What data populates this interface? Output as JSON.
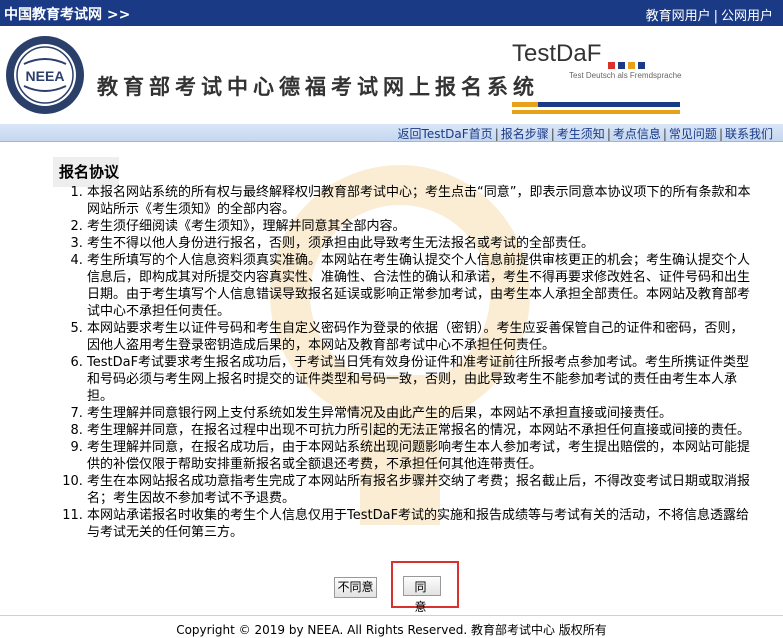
{
  "topbar": {
    "site": "中国教育考试网 >>",
    "user_link": "教育网用户",
    "separator": "|",
    "public_link": "公网用户"
  },
  "header": {
    "logo_text": "NEEA",
    "title": "教育部考试中心德福考试网上报名系统",
    "brand": "TestDaF",
    "brand_sub": "Test Deutsch als Fremdsprache"
  },
  "nav": {
    "items": [
      "返回TestDaF首页",
      "报名步骤",
      "考生须知",
      "考点信息",
      "常见问题",
      "联系我们"
    ]
  },
  "agreement": {
    "heading": "报名协议",
    "items": [
      "本报名网站系统的所有权与最终解释权归教育部考试中心；考生点击“同意”，即表示同意本协议项下的所有条款和本网站所示《考生须知》的全部内容。",
      "考生须仔细阅读《考生须知》，理解并同意其全部内容。",
      "考生不得以他人身份进行报名，否则，须承担由此导致考生无法报名或考试的全部责任。",
      "考生所填写的个人信息资料须真实准确。本网站在考生确认提交个人信息前提供审核更正的机会；考生确认提交个人信息后，即构成其对所提交内容真实性、准确性、合法性的确认和承诺，考生不得再要求修改姓名、证件号码和出生日期。由于考生填写个人信息错误导致报名延误或影响正常参加考试，由考生本人承担全部责任。本网站及教育部考试中心不承担任何责任。",
      "本网站要求考生以证件号码和考生自定义密码作为登录的依据（密钥）。考生应妥善保管自己的证件和密码，否则，因他人盗用考生登录密钥造成后果的，本网站及教育部考试中心不承担任何责任。",
      "TestDaF考试要求考生报名成功后，于考试当日凭有效身份证件和准考证前往所报考点参加考试。考生所携证件类型和号码必须与考生网上报名时提交的证件类型和号码一致，否则，由此导致考生不能参加考试的责任由考生本人承担。",
      "考生理解并同意银行网上支付系统如发生异常情况及由此产生的后果，本网站不承担直接或间接责任。",
      "考生理解并同意，在报名过程中出现不可抗力所引起的无法正常报名的情况，本网站不承担任何直接或间接的责任。",
      "考生理解并同意，在报名成功后，由于本网站系统出现问题影响考生本人参加考试，考生提出赔偿的，本网站可能提供的补偿仅限于帮助安排重新报名或全额退还考费，不承担任何其他连带责任。",
      "考生在本网站报名成功意指考生完成了本网站所有报名步骤并交纳了考费；报名截止后，不得改变考试日期或取消报名；考生因故不参加考试不予退费。",
      "本网站承诺报名时收集的考生个人信息仅用于TestDaF考试的实施和报告成绩等与考试有关的活动，不将信息透露给与考试无关的任何第三方。"
    ]
  },
  "buttons": {
    "disagree": "不同意",
    "agree": "同意"
  },
  "footer": {
    "copyright": "Copyright © 2019 by NEEA. All Rights Reserved. 教育部考试中心 版权所有"
  },
  "colors": {
    "topbar": "#1a3a86",
    "accent_orange": "#e8a21a",
    "accent_blue": "#1a3a86",
    "highlight": "#d9322c"
  }
}
